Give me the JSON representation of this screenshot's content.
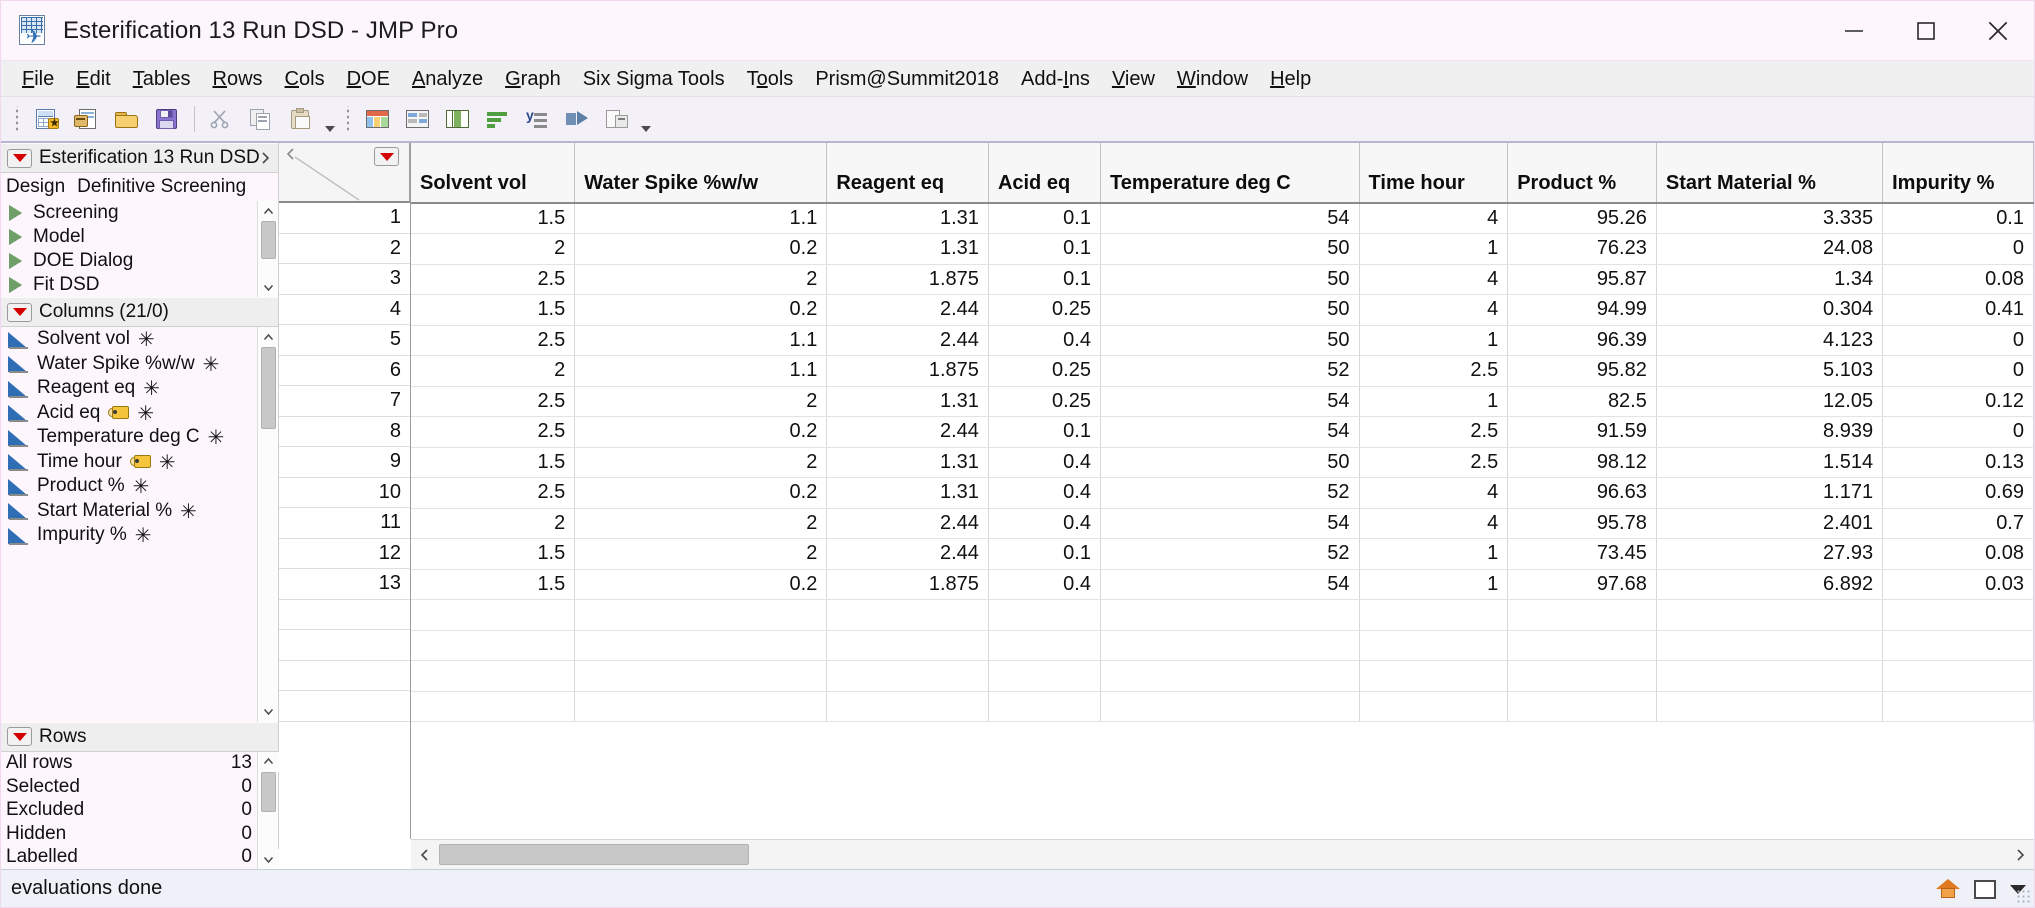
{
  "window": {
    "title": "Esterification 13 Run DSD - JMP Pro",
    "app_icon": "jmp-data-table-icon",
    "minimize_label": "Minimize",
    "maximize_label": "Maximize",
    "close_label": "Close"
  },
  "menubar": {
    "items": [
      {
        "label": "File",
        "mnemonic": "F"
      },
      {
        "label": "Edit",
        "mnemonic": "E"
      },
      {
        "label": "Tables",
        "mnemonic": "T"
      },
      {
        "label": "Rows",
        "mnemonic": "R"
      },
      {
        "label": "Cols",
        "mnemonic": "C"
      },
      {
        "label": "DOE",
        "mnemonic": "D"
      },
      {
        "label": "Analyze",
        "mnemonic": "A"
      },
      {
        "label": "Graph",
        "mnemonic": "G"
      },
      {
        "label": "Six Sigma Tools",
        "mnemonic": "S"
      },
      {
        "label": "Tools",
        "mnemonic": "o"
      },
      {
        "label": "Prism@Summit2018",
        "mnemonic": ""
      },
      {
        "label": "Add-Ins",
        "mnemonic": "I"
      },
      {
        "label": "View",
        "mnemonic": "V"
      },
      {
        "label": "Window",
        "mnemonic": "W"
      },
      {
        "label": "Help",
        "mnemonic": "H"
      }
    ]
  },
  "toolbar": {
    "group1": [
      {
        "name": "new-data-table-button"
      },
      {
        "name": "new-script-button"
      },
      {
        "name": "open-file-button"
      },
      {
        "name": "save-file-button"
      }
    ],
    "group1b": [
      {
        "name": "cut-button"
      },
      {
        "name": "copy-button"
      },
      {
        "name": "paste-button"
      }
    ],
    "group2": [
      {
        "name": "subset-table-button"
      },
      {
        "name": "summary-table-button"
      },
      {
        "name": "split-table-button"
      },
      {
        "name": "sort-table-button"
      },
      {
        "name": "stack-table-button"
      },
      {
        "name": "transpose-table-button"
      },
      {
        "name": "join-table-button"
      }
    ]
  },
  "left_panel": {
    "table_header": {
      "label": "Esterification 13 Run DSD",
      "redtriangle_name": "table-red-triangle-menu"
    },
    "design_row": {
      "key": "Design",
      "value": "Definitive Screening"
    },
    "tree_items": [
      {
        "label": "Screening"
      },
      {
        "label": "Model"
      },
      {
        "label": "DOE Dialog"
      },
      {
        "label": "Fit DSD"
      }
    ],
    "columns_header": {
      "label": "Columns (21/0)"
    },
    "columns": [
      {
        "label": "Solvent vol",
        "modeling": "continuous",
        "has_tag": false,
        "required": true
      },
      {
        "label": "Water Spike %w/w",
        "modeling": "continuous",
        "has_tag": false,
        "required": true
      },
      {
        "label": "Reagent eq",
        "modeling": "continuous",
        "has_tag": false,
        "required": true
      },
      {
        "label": "Acid eq",
        "modeling": "continuous",
        "has_tag": true,
        "required": true
      },
      {
        "label": "Temperature deg C",
        "modeling": "continuous",
        "has_tag": false,
        "required": true
      },
      {
        "label": "Time hour",
        "modeling": "continuous",
        "has_tag": true,
        "required": true
      },
      {
        "label": "Product %",
        "modeling": "continuous",
        "has_tag": false,
        "required": true
      },
      {
        "label": "Start Material %",
        "modeling": "continuous",
        "has_tag": false,
        "required": true
      },
      {
        "label": "Impurity %",
        "modeling": "continuous",
        "has_tag": false,
        "required": true
      }
    ],
    "rows_header": {
      "label": "Rows"
    },
    "rows_stats": [
      {
        "label": "All rows",
        "value": "13"
      },
      {
        "label": "Selected",
        "value": "0"
      },
      {
        "label": "Excluded",
        "value": "0"
      },
      {
        "label": "Hidden",
        "value": "0"
      },
      {
        "label": "Labelled",
        "value": "0"
      }
    ]
  },
  "table": {
    "corner_redtriangle_name": "columns-red-triangle-menu",
    "columns": [
      "Solvent vol",
      "Water Spike %w/w",
      "Reagent eq",
      "Acid eq",
      "Temperature deg C",
      "Time hour",
      "Product %",
      "Start Material %",
      "Impurity %"
    ],
    "row_numbers": [
      "1",
      "2",
      "3",
      "4",
      "5",
      "6",
      "7",
      "8",
      "9",
      "10",
      "11",
      "12",
      "13"
    ],
    "rows": [
      [
        "1.5",
        "1.1",
        "1.31",
        "0.1",
        "54",
        "4",
        "95.26",
        "3.335",
        "0.1"
      ],
      [
        "2",
        "0.2",
        "1.31",
        "0.1",
        "50",
        "1",
        "76.23",
        "24.08",
        "0"
      ],
      [
        "2.5",
        "2",
        "1.875",
        "0.1",
        "50",
        "4",
        "95.87",
        "1.34",
        "0.08"
      ],
      [
        "1.5",
        "0.2",
        "2.44",
        "0.25",
        "50",
        "4",
        "94.99",
        "0.304",
        "0.41"
      ],
      [
        "2.5",
        "1.1",
        "2.44",
        "0.4",
        "50",
        "1",
        "96.39",
        "4.123",
        "0"
      ],
      [
        "2",
        "1.1",
        "1.875",
        "0.25",
        "52",
        "2.5",
        "95.82",
        "5.103",
        "0"
      ],
      [
        "2.5",
        "2",
        "1.31",
        "0.25",
        "54",
        "1",
        "82.5",
        "12.05",
        "0.12"
      ],
      [
        "2.5",
        "0.2",
        "2.44",
        "0.1",
        "54",
        "2.5",
        "91.59",
        "8.939",
        "0"
      ],
      [
        "1.5",
        "2",
        "1.31",
        "0.4",
        "50",
        "2.5",
        "98.12",
        "1.514",
        "0.13"
      ],
      [
        "2.5",
        "0.2",
        "1.31",
        "0.4",
        "52",
        "4",
        "96.63",
        "1.171",
        "0.69"
      ],
      [
        "2",
        "2",
        "2.44",
        "0.4",
        "54",
        "4",
        "95.78",
        "2.401",
        "0.7"
      ],
      [
        "1.5",
        "2",
        "2.44",
        "0.1",
        "52",
        "1",
        "73.45",
        "27.93",
        "0.08"
      ],
      [
        "1.5",
        "0.2",
        "1.875",
        "0.4",
        "54",
        "1",
        "97.68",
        "6.892",
        "0.03"
      ]
    ],
    "empty_row_count": 4
  },
  "statusbar": {
    "message": "evaluations done",
    "home_icon": "home-icon",
    "window_icon": "window-icon",
    "dropdown_icon": "chevron-down-icon"
  },
  "colors": {
    "titlebar_bg": "#fdf6fd",
    "menubar_bg": "#f0f0f0",
    "toolbar_bg": "#f3f0f8",
    "panel_bg": "#fdf7fd",
    "header_bg": "#f7f7f7",
    "status_bg": "#eef2f8",
    "red_triangle": "#d40000",
    "continuous_blue": "#2f6db5",
    "tree_green": "#6fa06a"
  }
}
